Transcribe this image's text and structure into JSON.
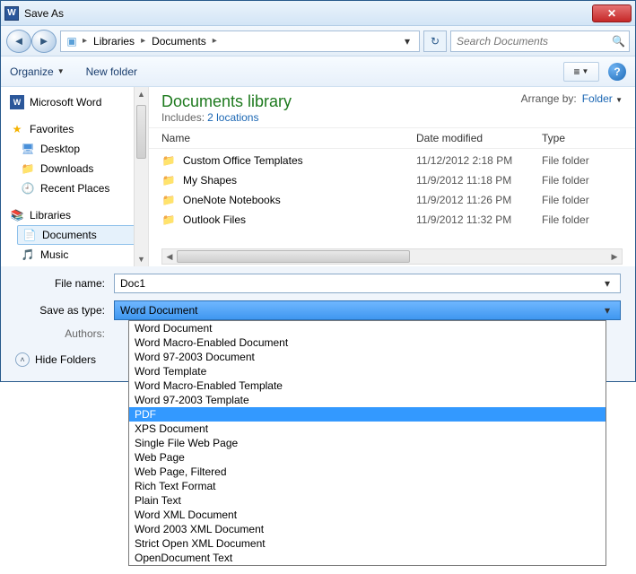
{
  "window": {
    "title": "Save As"
  },
  "nav": {
    "path": [
      "Libraries",
      "Documents"
    ],
    "search_placeholder": "Search Documents"
  },
  "toolbar": {
    "organize": "Organize",
    "new_folder": "New folder"
  },
  "sidebar": {
    "word": "Microsoft Word",
    "favorites": "Favorites",
    "fav_items": [
      "Desktop",
      "Downloads",
      "Recent Places"
    ],
    "libraries": "Libraries",
    "lib_items": [
      "Documents",
      "Music"
    ]
  },
  "library": {
    "title": "Documents library",
    "includes_label": "Includes:",
    "includes_link": "2 locations",
    "arrange_label": "Arrange by:",
    "arrange_value": "Folder"
  },
  "columns": {
    "name": "Name",
    "modified": "Date modified",
    "type": "Type"
  },
  "rows": [
    {
      "name": "Custom Office Templates",
      "date": "11/12/2012 2:18 PM",
      "type": "File folder"
    },
    {
      "name": "My Shapes",
      "date": "11/9/2012 11:18 PM",
      "type": "File folder"
    },
    {
      "name": "OneNote Notebooks",
      "date": "11/9/2012 11:26 PM",
      "type": "File folder"
    },
    {
      "name": "Outlook Files",
      "date": "11/9/2012 11:32 PM",
      "type": "File folder"
    }
  ],
  "form": {
    "filename_label": "File name:",
    "filename_value": "Doc1",
    "savetype_label": "Save as type:",
    "savetype_value": "Word Document",
    "authors_label": "Authors:"
  },
  "formats": [
    "Word Document",
    "Word Macro-Enabled Document",
    "Word 97-2003 Document",
    "Word Template",
    "Word Macro-Enabled Template",
    "Word 97-2003 Template",
    "PDF",
    "XPS Document",
    "Single File Web Page",
    "Web Page",
    "Web Page, Filtered",
    "Rich Text Format",
    "Plain Text",
    "Word XML Document",
    "Word 2003 XML Document",
    "Strict Open XML Document",
    "OpenDocument Text"
  ],
  "formats_selected_index": 6,
  "hide_folders": "Hide Folders"
}
